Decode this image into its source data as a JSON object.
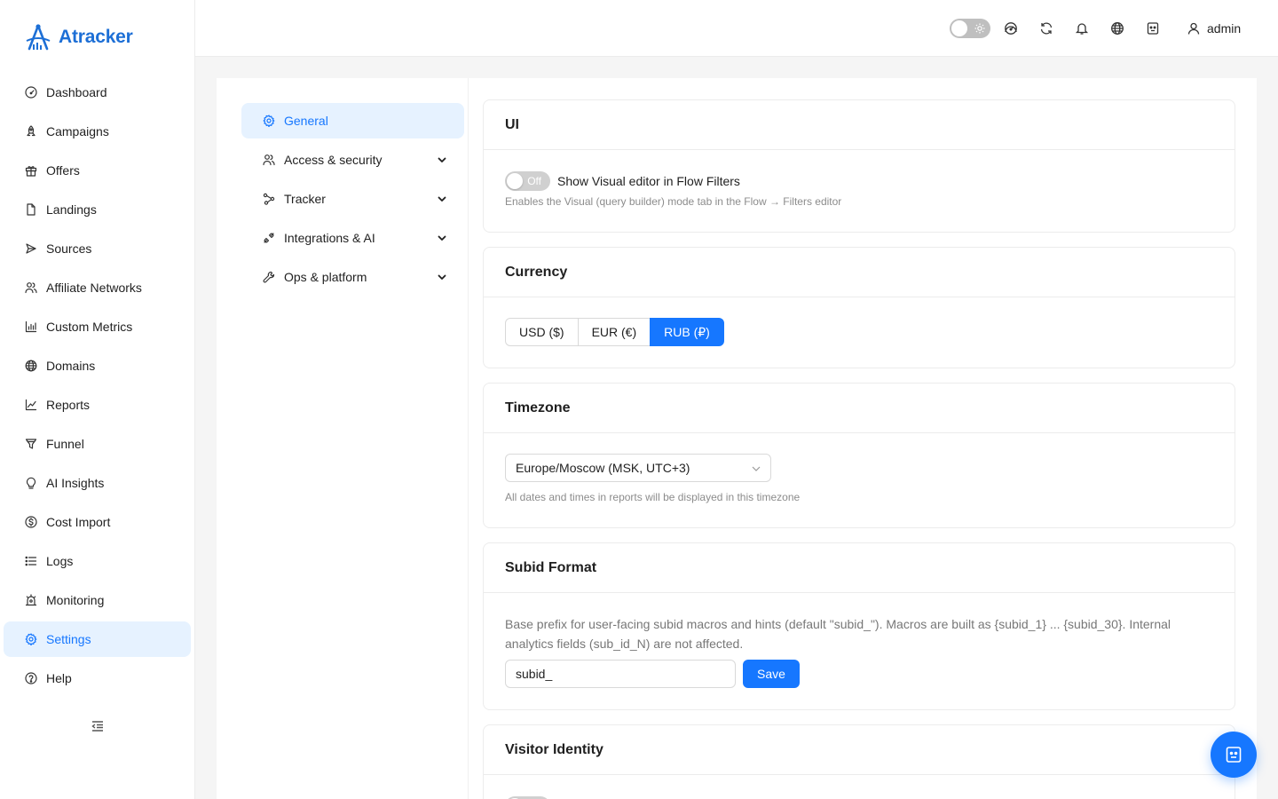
{
  "app": {
    "name": "Atracker"
  },
  "sidebar": {
    "items": [
      {
        "label": "Dashboard",
        "icon": "dashboard-icon"
      },
      {
        "label": "Campaigns",
        "icon": "rocket-icon"
      },
      {
        "label": "Offers",
        "icon": "gift-icon"
      },
      {
        "label": "Landings",
        "icon": "file-icon"
      },
      {
        "label": "Sources",
        "icon": "send-icon"
      },
      {
        "label": "Affiliate Networks",
        "icon": "users-icon"
      },
      {
        "label": "Custom Metrics",
        "icon": "bar-chart-icon"
      },
      {
        "label": "Domains",
        "icon": "globe-icon"
      },
      {
        "label": "Reports",
        "icon": "line-chart-icon"
      },
      {
        "label": "Funnel",
        "icon": "funnel-icon"
      },
      {
        "label": "AI Insights",
        "icon": "bulb-icon"
      },
      {
        "label": "Cost Import",
        "icon": "dollar-icon"
      },
      {
        "label": "Logs",
        "icon": "list-icon"
      },
      {
        "label": "Monitoring",
        "icon": "alert-icon"
      },
      {
        "label": "Settings",
        "icon": "gear-icon",
        "active": true
      },
      {
        "label": "Help",
        "icon": "question-icon"
      }
    ]
  },
  "header": {
    "user": "admin",
    "icons": [
      "dashboard-icon",
      "sync-icon",
      "bell-icon",
      "globe-icon",
      "robot-icon"
    ]
  },
  "settings_nav": {
    "items": [
      {
        "label": "General",
        "icon": "gear-icon",
        "active": true
      },
      {
        "label": "Access & security",
        "icon": "users-icon",
        "expandable": true
      },
      {
        "label": "Tracker",
        "icon": "node-icon",
        "expandable": true
      },
      {
        "label": "Integrations & AI",
        "icon": "api-icon",
        "expandable": true
      },
      {
        "label": "Ops & platform",
        "icon": "tool-icon",
        "expandable": true
      }
    ]
  },
  "ui_card": {
    "title": "UI",
    "switch_state": "Off",
    "switch_label": "Show Visual editor in Flow Filters",
    "hint": "Enables the Visual (query builder) mode tab in the Flow → Filters editor"
  },
  "currency_card": {
    "title": "Currency",
    "options": [
      "USD ($)",
      "EUR (€)",
      "RUB (₽)"
    ],
    "selected": "RUB (₽)"
  },
  "timezone_card": {
    "title": "Timezone",
    "value": "Europe/Moscow (MSK, UTC+3)",
    "hint": "All dates and times in reports will be displayed in this timezone"
  },
  "subid_card": {
    "title": "Subid Format",
    "description": "Base prefix for user-facing subid macros and hints (default \"subid_\"). Macros are built as {subid_1} ... {subid_30}. Internal analytics fields (sub_id_N) are not affected.",
    "value": "subid_",
    "save_label": "Save"
  },
  "visitor_card": {
    "title": "Visitor Identity"
  },
  "colors": {
    "accent": "#1677ff",
    "brand": "#1d6fd6",
    "active_bg": "#e6f2ff"
  }
}
